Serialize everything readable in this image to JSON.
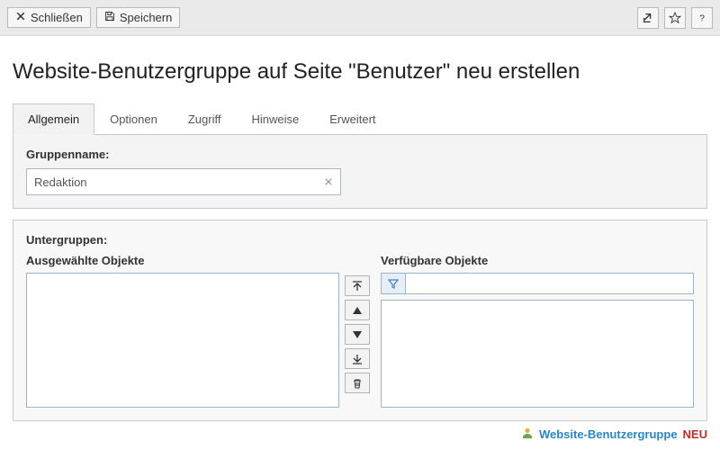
{
  "toolbar": {
    "close_label": "Schließen",
    "save_label": "Speichern"
  },
  "page_title": "Website-Benutzergruppe auf Seite \"Benutzer\" neu erstellen",
  "tabs": [
    {
      "label": "Allgemein",
      "active": true
    },
    {
      "label": "Optionen",
      "active": false
    },
    {
      "label": "Zugriff",
      "active": false
    },
    {
      "label": "Hinweise",
      "active": false
    },
    {
      "label": "Erweitert",
      "active": false
    }
  ],
  "form": {
    "groupname_label": "Gruppenname:",
    "groupname_value": "Redaktion",
    "subgroups_label": "Untergruppen:",
    "selected_label": "Ausgewählte Objekte",
    "available_label": "Verfügbare Objekte",
    "filter_value": ""
  },
  "footer": {
    "type_label": "Website-Benutzergruppe",
    "status": "NEU"
  },
  "icons": {
    "close": "close-icon",
    "save": "save-icon",
    "share": "share-icon",
    "star": "star-icon",
    "help": "help-icon",
    "move_top": "move-top-icon",
    "move_up": "move-up-icon",
    "move_down": "move-down-icon",
    "move_bottom": "move-bottom-icon",
    "delete": "delete-icon",
    "filter": "filter-icon",
    "user": "user-icon"
  }
}
